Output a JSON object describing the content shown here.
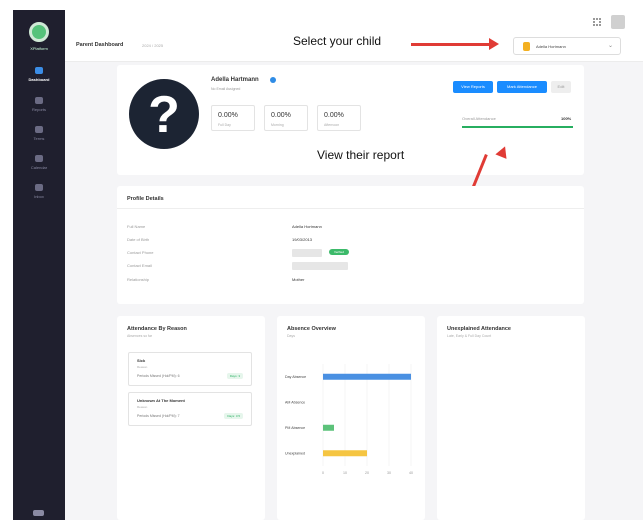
{
  "app": {
    "logo_label": "XPlatform"
  },
  "sidebar": {
    "items": [
      {
        "label": "Dashboard",
        "icon": "home-icon"
      },
      {
        "label": "Reports",
        "icon": "chart-icon"
      },
      {
        "label": "Terms",
        "icon": "calendar-icon"
      },
      {
        "label": "Calendar",
        "icon": "calendar-icon"
      },
      {
        "label": "Inbox",
        "icon": "mail-icon"
      }
    ]
  },
  "header": {
    "title": "Parent Dashboard",
    "subtitle": "2024 / 2025",
    "child_select": {
      "value": "Adella Hortmann"
    }
  },
  "annotations": {
    "select_child": "Select your child",
    "view_report": "View their report"
  },
  "profile": {
    "name": "Adella Hartmann",
    "email": "No Email Assigned",
    "stats": [
      {
        "value": "0.00%",
        "label": "Full Day"
      },
      {
        "value": "0.00%",
        "label": "Morning"
      },
      {
        "value": "0.00%",
        "label": "Afternoon"
      }
    ],
    "buttons": {
      "view_reports": "View Reports",
      "mark_attendance": "Mark Attendance",
      "edit": "Edit"
    },
    "overall": {
      "label": "Overall Attendance",
      "value": "100%",
      "fill": 1.0
    }
  },
  "profile_details": {
    "title": "Profile Details",
    "rows": [
      {
        "key": "Full Name",
        "value": "Adella Hortmann"
      },
      {
        "key": "Date of Birth",
        "value": "19/03/2013"
      },
      {
        "key": "Contact Phone",
        "value": ""
      },
      {
        "key": "Contact Email",
        "value": ""
      },
      {
        "key": "Relationship",
        "value": "Mother"
      }
    ],
    "verified_label": "Verified"
  },
  "attendance_by_reason": {
    "title": "Attendance By Reason",
    "subtitle": "Absences so far",
    "items": [
      {
        "title": "Sick",
        "sub": "Reason",
        "periods": "Periods Missed (Hol/PM): 6",
        "pill": "Days: 3"
      },
      {
        "title": "Unknown At The Moment",
        "sub": "Reason",
        "periods": "Periods Missed (Hol/PM): 7",
        "pill": "Days: 3.5"
      }
    ]
  },
  "absence_overview": {
    "title": "Absence Overview",
    "subtitle": "Days"
  },
  "unexplained_attendance": {
    "title": "Unexplained Attendance",
    "subtitle": "Late, Early & Full Day Count"
  },
  "chart_data": {
    "type": "bar",
    "orientation": "horizontal",
    "categories": [
      "Day Absence",
      "AM Absence",
      "PM Absence",
      "Unexplained"
    ],
    "values": [
      40,
      0,
      5,
      20
    ],
    "colors": [
      "#4a90e2",
      "#4a90e2",
      "#5cc27a",
      "#f5c542"
    ],
    "xlim": [
      0,
      40
    ],
    "xticks": [
      0,
      10,
      20,
      30,
      40
    ],
    "grid": true
  }
}
